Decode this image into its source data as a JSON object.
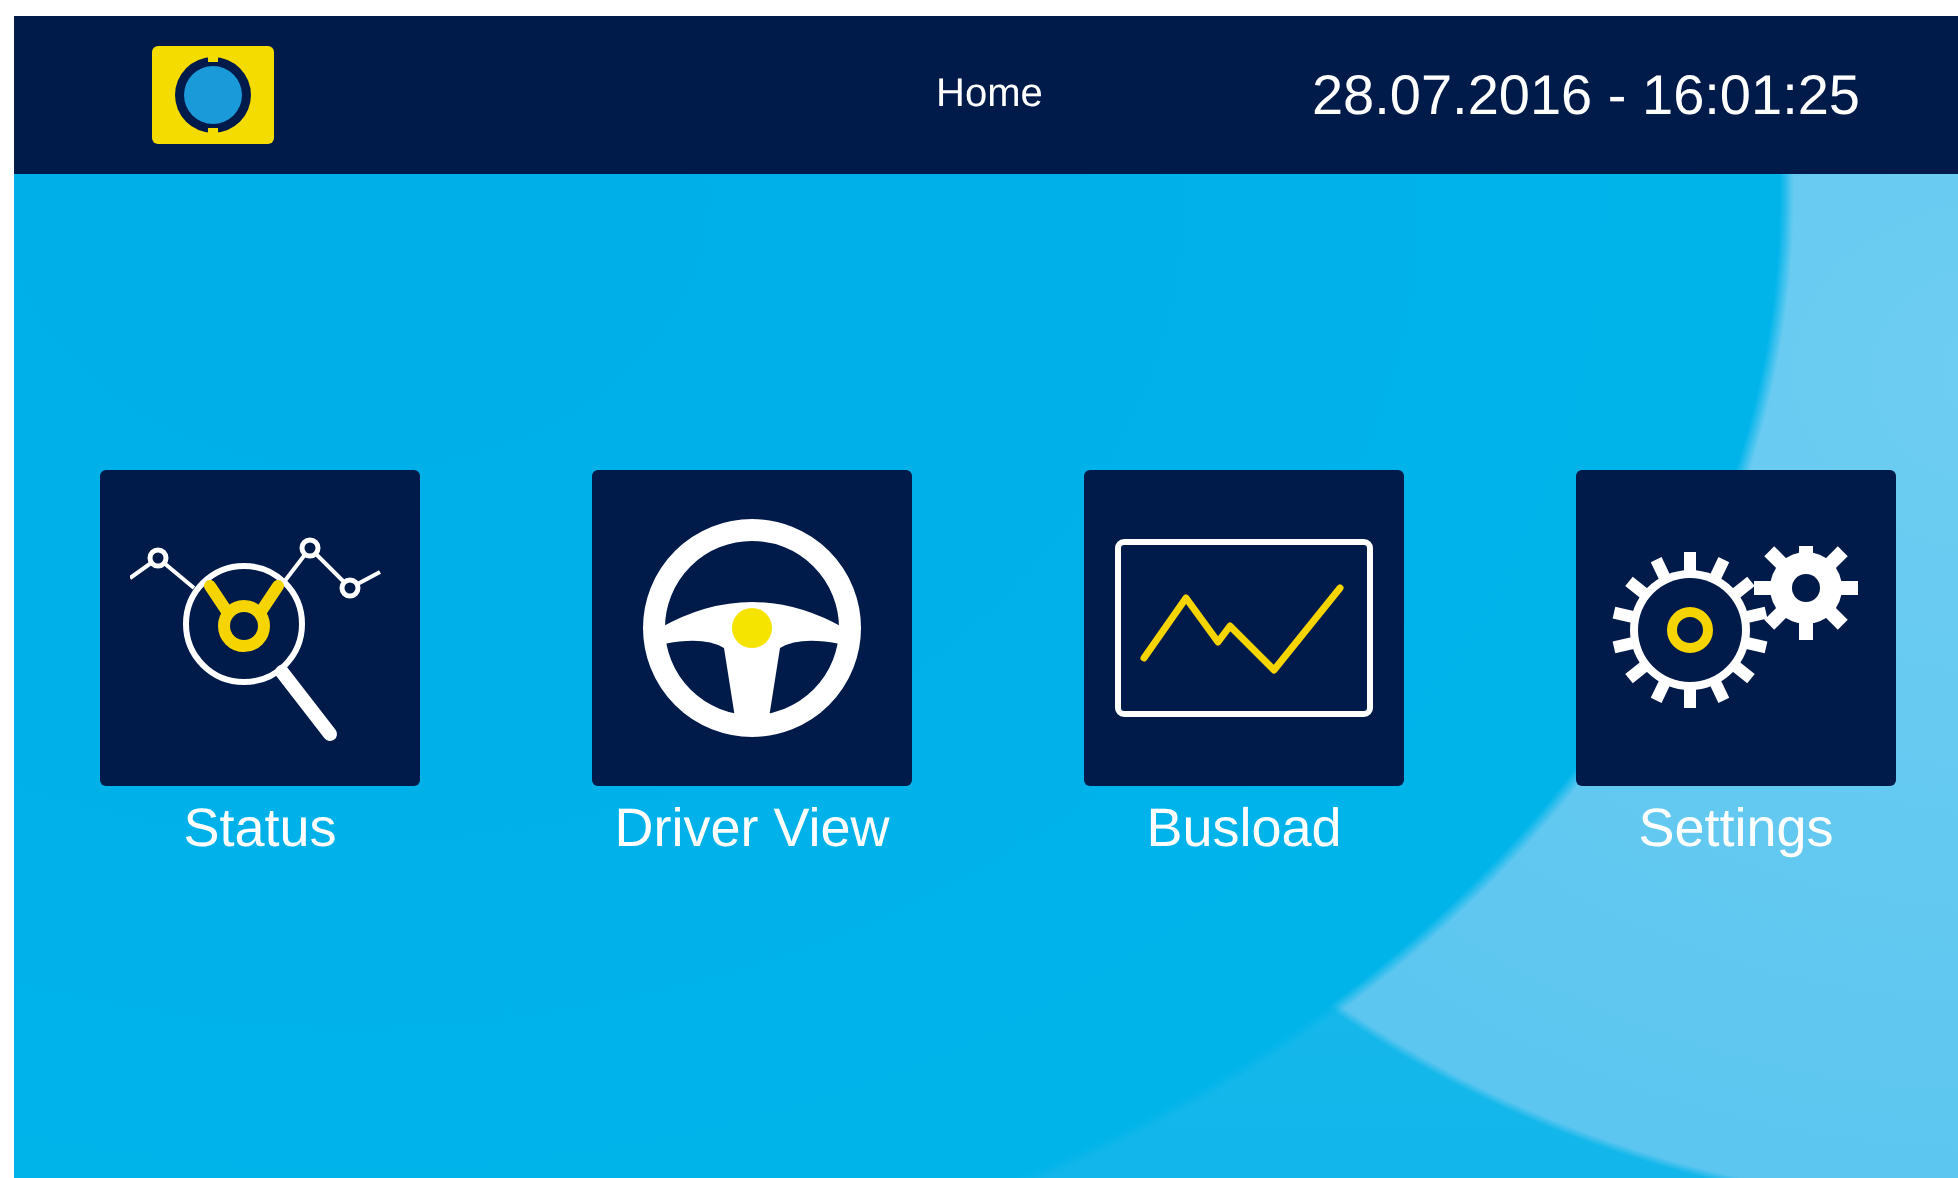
{
  "header": {
    "title": "Home",
    "datetime": "28.07.2016 - 16:01:25"
  },
  "tiles": [
    {
      "kind": "status",
      "label": "Status"
    },
    {
      "kind": "driver",
      "label": "Driver View"
    },
    {
      "kind": "busload",
      "label": "Busload"
    },
    {
      "kind": "settings",
      "label": "Settings"
    }
  ]
}
